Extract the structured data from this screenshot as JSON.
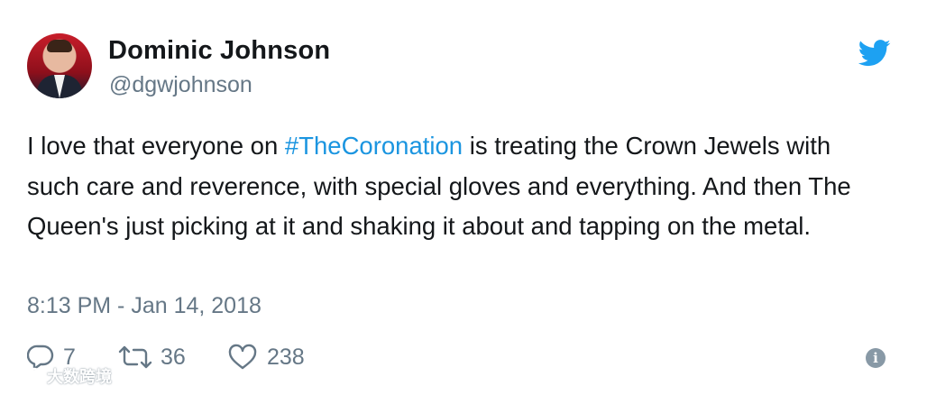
{
  "author": {
    "name": "Dominic Johnson",
    "handle": "@dgwjohnson"
  },
  "tweet": {
    "text_before": "I love that everyone on ",
    "hashtag": "#TheCoronation",
    "text_after": " is treating the Crown Jewels with such care and reverence, with special gloves and everything. And then The Queen's just picking at it and shaking it about and tapping on the metal.",
    "timestamp": "8:13 PM - Jan 14, 2018"
  },
  "actions": {
    "replies": "7",
    "retweets": "36",
    "likes": "238"
  },
  "icons": {
    "brand": "twitter-bird-icon",
    "reply": "reply-icon",
    "retweet": "retweet-icon",
    "like": "heart-icon",
    "info": "info-icon"
  },
  "colors": {
    "hashtag": "#1b95e0",
    "twitter_blue": "#1da1f2",
    "secondary_text": "#657786",
    "primary_text": "#14171a"
  },
  "watermark": {
    "text": "大数跨境"
  }
}
